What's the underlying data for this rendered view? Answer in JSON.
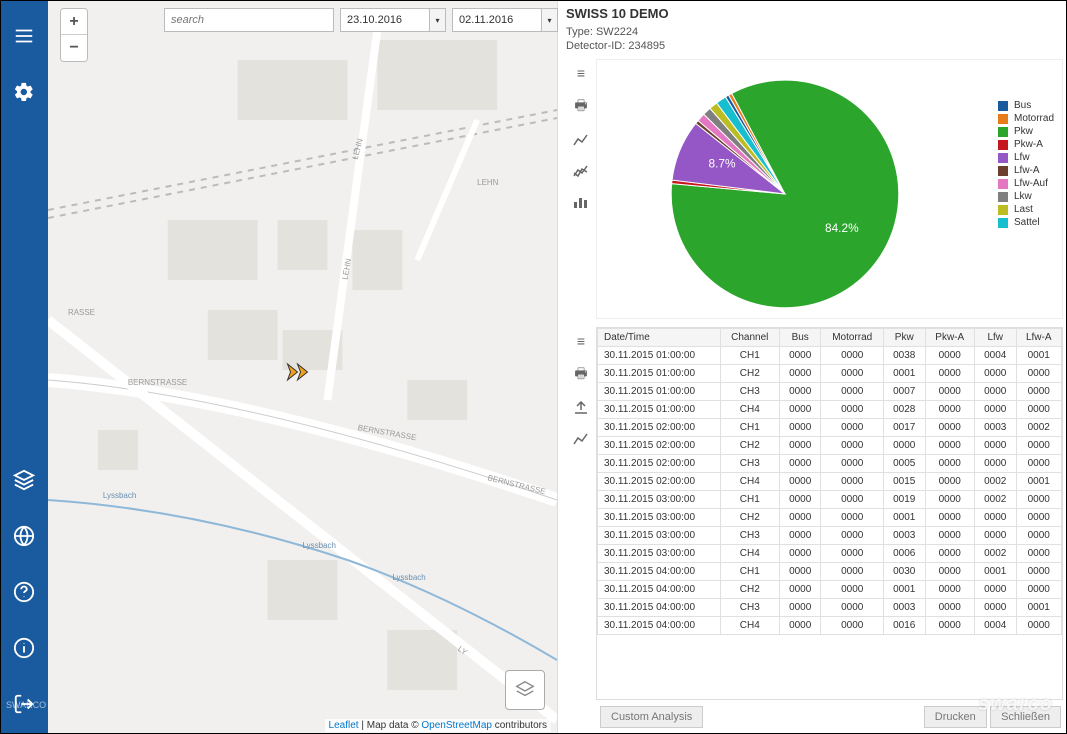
{
  "sidebar": {
    "icons": [
      "menu",
      "settings",
      "layers",
      "globe",
      "help",
      "info",
      "logout"
    ],
    "footer": "SWARCO | First in Traffic Solutions"
  },
  "map": {
    "search_placeholder": "search",
    "date_from": "23.10.2016",
    "date_to": "02.11.2016",
    "streets": {
      "lehn": "LEHN",
      "bernstrasse": "BERNSTRASSE",
      "lyssbach": "Lyssbach",
      "rasse": "RASSE",
      "ly": "LY"
    },
    "attrib": {
      "leaflet": "Leaflet",
      "mid": " | Map data © ",
      "osm": "OpenStreetMap",
      "tail": " contributors"
    }
  },
  "detail": {
    "title": "SWISS 10 DEMO",
    "type_label": "Type: ",
    "type_value": "SW2224",
    "detector_label": "Detector-ID: ",
    "detector_value": "234895"
  },
  "chart_data": {
    "type": "pie",
    "series": [
      {
        "name": "Bus",
        "value": 0.5,
        "color": "#1a5a9e"
      },
      {
        "name": "Motorrad",
        "value": 0.5,
        "color": "#e87b1a"
      },
      {
        "name": "Pkw",
        "value": 84.2,
        "color": "#2ba52b",
        "label": "84.2%"
      },
      {
        "name": "Pkw-A",
        "value": 0.5,
        "color": "#c4161c"
      },
      {
        "name": "Lfw",
        "value": 8.7,
        "color": "#9557c6",
        "label": "8.7%"
      },
      {
        "name": "Lfw-A",
        "value": 0.5,
        "color": "#6b3e2e"
      },
      {
        "name": "Lfw-Auf",
        "value": 1.2,
        "color": "#e377c2"
      },
      {
        "name": "Lkw",
        "value": 1.2,
        "color": "#7f7f7f"
      },
      {
        "name": "Last",
        "value": 1.2,
        "color": "#bcbd22"
      },
      {
        "name": "Sattel",
        "value": 1.5,
        "color": "#17becf"
      }
    ]
  },
  "table": {
    "headers": [
      "Date/Time",
      "Channel",
      "Bus",
      "Motorrad",
      "Pkw",
      "Pkw-A",
      "Lfw",
      "Lfw-A"
    ],
    "rows": [
      [
        "30.11.2015 01:00:00",
        "CH1",
        "0000",
        "0000",
        "0038",
        "0000",
        "0004",
        "0001"
      ],
      [
        "30.11.2015 01:00:00",
        "CH2",
        "0000",
        "0000",
        "0001",
        "0000",
        "0000",
        "0000"
      ],
      [
        "30.11.2015 01:00:00",
        "CH3",
        "0000",
        "0000",
        "0007",
        "0000",
        "0000",
        "0000"
      ],
      [
        "30.11.2015 01:00:00",
        "CH4",
        "0000",
        "0000",
        "0028",
        "0000",
        "0000",
        "0000"
      ],
      [
        "30.11.2015 02:00:00",
        "CH1",
        "0000",
        "0000",
        "0017",
        "0000",
        "0003",
        "0002"
      ],
      [
        "30.11.2015 02:00:00",
        "CH2",
        "0000",
        "0000",
        "0000",
        "0000",
        "0000",
        "0000"
      ],
      [
        "30.11.2015 02:00:00",
        "CH3",
        "0000",
        "0000",
        "0005",
        "0000",
        "0000",
        "0000"
      ],
      [
        "30.11.2015 02:00:00",
        "CH4",
        "0000",
        "0000",
        "0015",
        "0000",
        "0002",
        "0001"
      ],
      [
        "30.11.2015 03:00:00",
        "CH1",
        "0000",
        "0000",
        "0019",
        "0000",
        "0002",
        "0000"
      ],
      [
        "30.11.2015 03:00:00",
        "CH2",
        "0000",
        "0000",
        "0001",
        "0000",
        "0000",
        "0000"
      ],
      [
        "30.11.2015 03:00:00",
        "CH3",
        "0000",
        "0000",
        "0003",
        "0000",
        "0000",
        "0000"
      ],
      [
        "30.11.2015 03:00:00",
        "CH4",
        "0000",
        "0000",
        "0006",
        "0000",
        "0002",
        "0000"
      ],
      [
        "30.11.2015 04:00:00",
        "CH1",
        "0000",
        "0000",
        "0030",
        "0000",
        "0001",
        "0000"
      ],
      [
        "30.11.2015 04:00:00",
        "CH2",
        "0000",
        "0000",
        "0001",
        "0000",
        "0000",
        "0000"
      ],
      [
        "30.11.2015 04:00:00",
        "CH3",
        "0000",
        "0000",
        "0003",
        "0000",
        "0000",
        "0001"
      ],
      [
        "30.11.2015 04:00:00",
        "CH4",
        "0000",
        "0000",
        "0016",
        "0000",
        "0004",
        "0000"
      ]
    ]
  },
  "buttons": {
    "custom": "Custom Analysis",
    "print": "Drucken",
    "close": "Schließen"
  },
  "brand": "swarco"
}
